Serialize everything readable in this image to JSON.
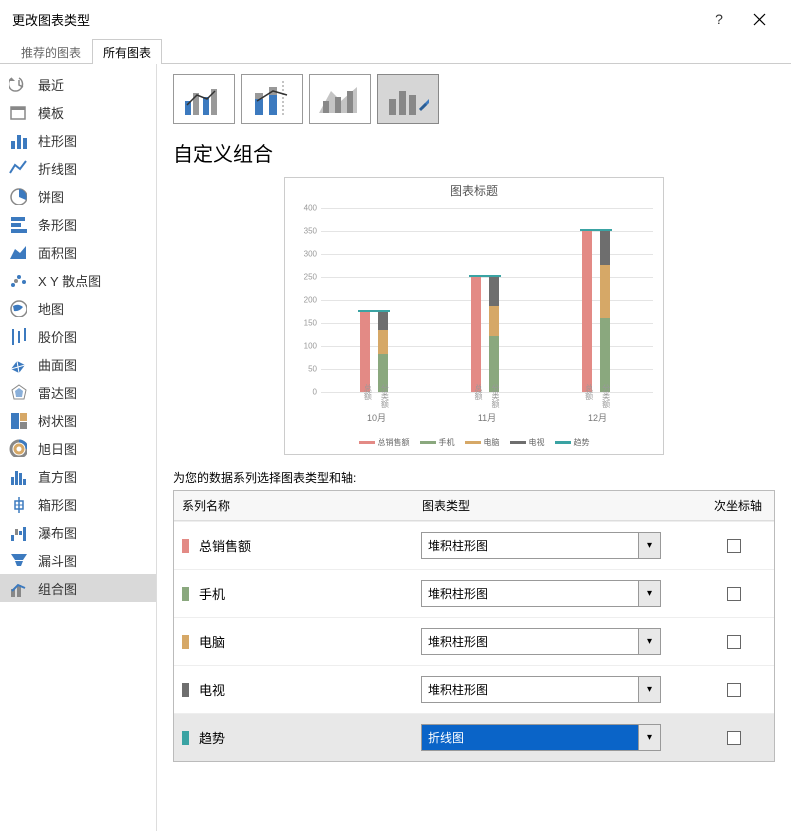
{
  "window": {
    "title": "更改图表类型"
  },
  "tabs": [
    {
      "label": "推荐的图表",
      "active": false
    },
    {
      "label": "所有图表",
      "active": true
    }
  ],
  "sidebar": [
    {
      "label": "最近",
      "icon": "recent"
    },
    {
      "label": "模板",
      "icon": "template"
    },
    {
      "label": "柱形图",
      "icon": "column"
    },
    {
      "label": "折线图",
      "icon": "line"
    },
    {
      "label": "饼图",
      "icon": "pie"
    },
    {
      "label": "条形图",
      "icon": "bar"
    },
    {
      "label": "面积图",
      "icon": "area"
    },
    {
      "label": "X Y 散点图",
      "icon": "scatter"
    },
    {
      "label": "地图",
      "icon": "map"
    },
    {
      "label": "股价图",
      "icon": "stock"
    },
    {
      "label": "曲面图",
      "icon": "surface"
    },
    {
      "label": "雷达图",
      "icon": "radar"
    },
    {
      "label": "树状图",
      "icon": "treemap"
    },
    {
      "label": "旭日图",
      "icon": "sunburst"
    },
    {
      "label": "直方图",
      "icon": "histogram"
    },
    {
      "label": "箱形图",
      "icon": "box"
    },
    {
      "label": "瀑布图",
      "icon": "waterfall"
    },
    {
      "label": "漏斗图",
      "icon": "funnel"
    },
    {
      "label": "组合图",
      "icon": "combo",
      "active": true
    }
  ],
  "main": {
    "title": "自定义组合",
    "preview_title": "图表标题",
    "series_instruction": "为您的数据系列选择图表类型和轴:",
    "headers": {
      "name": "系列名称",
      "type": "图表类型",
      "axis": "次坐标轴"
    },
    "series": [
      {
        "name": "总销售额",
        "type": "堆积柱形图",
        "color": "#e38a85",
        "selected": false
      },
      {
        "name": "手机",
        "type": "堆积柱形图",
        "color": "#8aa87e",
        "selected": false
      },
      {
        "name": "电脑",
        "type": "堆积柱形图",
        "color": "#d6a867",
        "selected": false
      },
      {
        "name": "电视",
        "type": "堆积柱形图",
        "color": "#6e6e6e",
        "selected": false
      },
      {
        "name": "趋势",
        "type": "折线图",
        "color": "#3aa3a3",
        "selected": true
      }
    ],
    "legend": [
      "总销售额",
      "手机",
      "电脑",
      "电视",
      "趋势"
    ]
  },
  "chart_data": {
    "type": "bar",
    "title": "图表标题",
    "ylim": [
      0,
      400
    ],
    "yticks": [
      0,
      50,
      100,
      150,
      200,
      250,
      300,
      350,
      400
    ],
    "categories": [
      "10月",
      "11月",
      "12月"
    ],
    "sub_categories": [
      "总额",
      "分类额"
    ],
    "series": [
      {
        "name": "总销售额",
        "color": "#e38a85",
        "values_total": [
          175,
          250,
          350
        ]
      },
      {
        "name": "手机",
        "color": "#8aa87e",
        "values_stack": [
          82,
          122,
          160
        ]
      },
      {
        "name": "电脑",
        "color": "#d6a867",
        "values_stack": [
          52,
          65,
          116
        ]
      },
      {
        "name": "电视",
        "color": "#6e6e6e",
        "values_stack": [
          41,
          63,
          74
        ]
      },
      {
        "name": "趋势",
        "color": "#3aa3a3",
        "type": "line",
        "values": [
          175,
          250,
          350
        ]
      }
    ]
  }
}
